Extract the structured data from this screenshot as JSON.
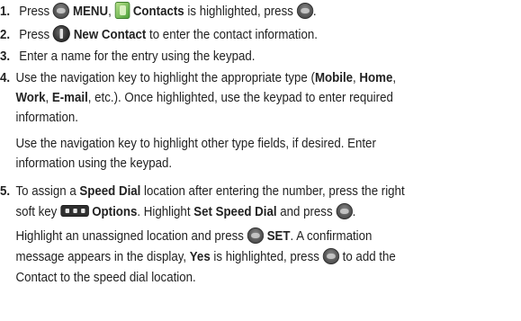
{
  "steps": [
    {
      "num": "1.",
      "t1": "Press",
      "k1": "MENU",
      "t2": ",",
      "k2": "Contacts",
      "t3": "is highlighted, press",
      "t4": "."
    },
    {
      "num": "2.",
      "t1": "Press",
      "k1": "New Contact",
      "t2": "to enter the contact information."
    },
    {
      "num": "3.",
      "t1": "Enter a name for the entry using the keypad."
    },
    {
      "num": "4.",
      "l1_a": "Use the navigation key to highlight the appropriate type (",
      "b1": "Mobile",
      "c1": ", ",
      "b2": "Home",
      "c2": ",",
      "l2_b3": "Work",
      "l2_c3": ", ",
      "l2_b4": "E-mail",
      "l2_rest": ", etc.). Once highlighted, use the keypad to enter required",
      "l3": "information.",
      "p2_l1": "Use the navigation key to highlight other type fields, if desired. Enter",
      "p2_l2": "information using the keypad."
    },
    {
      "num": "5.",
      "l1_a": "To assign a ",
      "b1": "Speed Dial",
      "l1_b": " location after entering the number, press the right",
      "l2_a": "soft key",
      "k_options": "Options",
      "l2_b": ". Highlight ",
      "b_set": "Set Speed Dial",
      "l2_c": " and press",
      "l2_d": ".",
      "p2_l1_a": "Highlight an unassigned location and press",
      "p2_set": "SET",
      "p2_l1_b": ".  A confirmation",
      "p2_l2_a": "message appears in the display, ",
      "p2_yes": "Yes",
      "p2_l2_b": " is highlighted, press",
      "p2_l2_c": "to add the",
      "p2_l3": "Contact to the speed dial location."
    }
  ],
  "icons": {
    "ok_key": "ok-key-icon",
    "contacts": "contacts-icon",
    "left_soft_key": "left-soft-key-icon",
    "right_soft_key": "right-soft-key-icon"
  }
}
